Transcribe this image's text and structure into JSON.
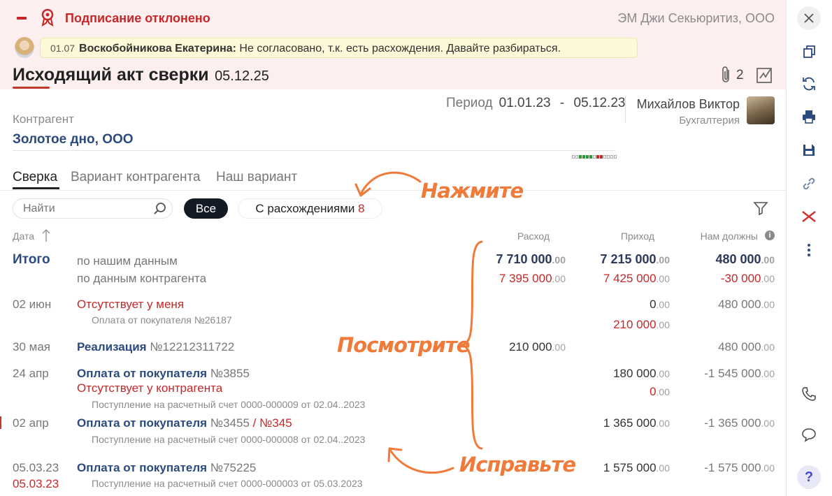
{
  "status": {
    "title": "Подписание отклонено",
    "company": "ЭМ Джи Секьюритиз, ООО"
  },
  "comment": {
    "date": "01.07",
    "author": "Воскобойникова Екатерина:",
    "text": " Не согласовано, т.к. есть расхождения. Давайте разбираться."
  },
  "doc": {
    "title": "Исходящий акт сверки",
    "date": "05.12.25",
    "attachments": "2"
  },
  "period": {
    "label": "Период",
    "from": "01.01.23",
    "dash": "-",
    "to": "05.12.23"
  },
  "responsible": {
    "name": "Михайлов Виктор",
    "dept": "Бухгалтерия"
  },
  "counterparty": {
    "label": "Контрагент",
    "name": "Золотое дно, ООО"
  },
  "tabs": [
    "Сверка",
    "Вариант контрагента",
    "Наш вариант"
  ],
  "search": {
    "placeholder": "Найти"
  },
  "filters": {
    "all": "Все",
    "diff": "С расхождениями",
    "diff_count": "8"
  },
  "columns": {
    "date": "Дата",
    "expense": "Расход",
    "income": "Приход",
    "owed": "Нам должны"
  },
  "totals": {
    "label": "Итого",
    "ours": "по нашим данным",
    "theirs": "по данным контрагента",
    "exp_ours": "7 710 000",
    "exp_theirs": "7 395 000",
    "inc_ours": "7 215 000",
    "inc_theirs": "7 425 000",
    "owed_ours": "480 000",
    "owed_theirs": "-30 000",
    "cents": ".00"
  },
  "rows": [
    {
      "date": "02 июн",
      "title": "Отсутствует у меня",
      "sub": "Оплата от покупателя  №26187",
      "inc": "0",
      "inc2": "210 000",
      "owed": "480 000"
    },
    {
      "date": "30 мая",
      "title": "Реализация",
      "num": "№12212311722",
      "exp": "210 000",
      "owed": "480 000"
    },
    {
      "date": "24 апр",
      "title": "Оплата от покупателя",
      "num": "№3855",
      "status": "Отсутствует у контрагента",
      "sub": "Поступление на расчетный счет 0000-000009 от 02.04..2023",
      "inc": "180 000",
      "inc2": "0",
      "owed": "-1 545 000"
    },
    {
      "date": "02 апр",
      "title": "Оплата от покупателя",
      "num": "№3455",
      "sep": " / ",
      "num2": "№345",
      "sub": "Поступление на расчетный счет 0000-000008 от 02.04..2023",
      "inc": "1 365 000",
      "owed": "-1 365 000"
    },
    {
      "date": "05.03.23",
      "date2": "05.03.23",
      "title": "Оплата от покупателя",
      "num": "№75225",
      "sub": "Поступление на расчетный счет 0000-000003 от 05.03.2023",
      "inc": "1 575 000",
      "owed": "-1 575 000"
    }
  ],
  "annotations": {
    "click": "Нажмите",
    "look": "Посмотрите",
    "fix": "Исправьте"
  },
  "colors": {
    "accent": "#c62828",
    "banner": "#fdeff0",
    "annotation": "#f07a3a",
    "dark": "#2b4a80"
  }
}
